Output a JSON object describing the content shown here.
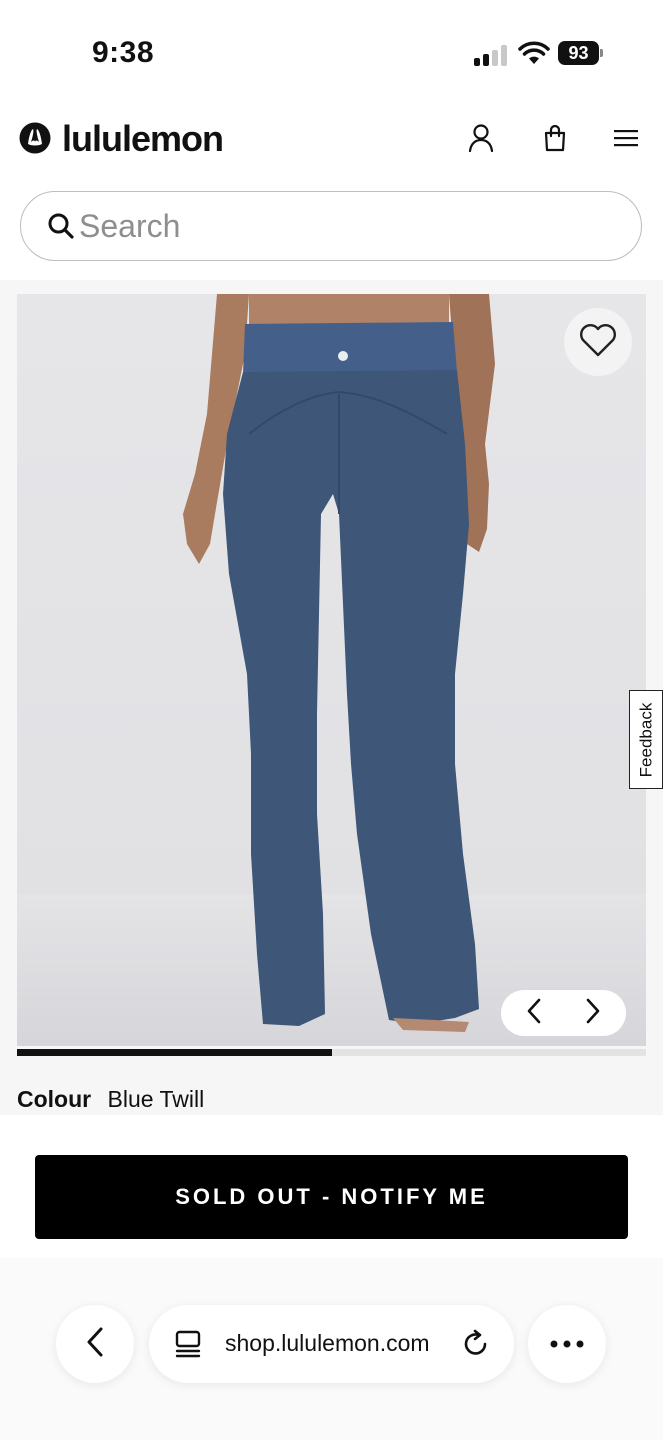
{
  "status_bar": {
    "time": "9:38",
    "battery_level": "93",
    "signal_bars_active": 2,
    "signal_bars_total": 4,
    "icons": [
      "cellular-signal-icon",
      "wifi-icon",
      "battery-icon"
    ]
  },
  "header": {
    "logo_text": "lululemon",
    "icons": [
      "account-icon",
      "shopping-bag-icon",
      "menu-icon"
    ]
  },
  "search": {
    "placeholder": "Search",
    "value": ""
  },
  "product": {
    "image_description_icon": "product-photo",
    "wishlist_icon": "heart-icon",
    "carousel_prev_icon": "chevron-left-icon",
    "carousel_next_icon": "chevron-right-icon",
    "image_progress": 0.5,
    "feedback_label": "Feedback",
    "colour_label": "Colour",
    "colour_value": "Blue Twill",
    "pant_color": "#3e5678"
  },
  "cta": {
    "notify_label": "SOLD OUT - NOTIFY ME"
  },
  "browser": {
    "url": "shop.lululemon.com",
    "icons": [
      "back-icon",
      "tabs-icon",
      "reload-icon",
      "more-icon"
    ]
  }
}
